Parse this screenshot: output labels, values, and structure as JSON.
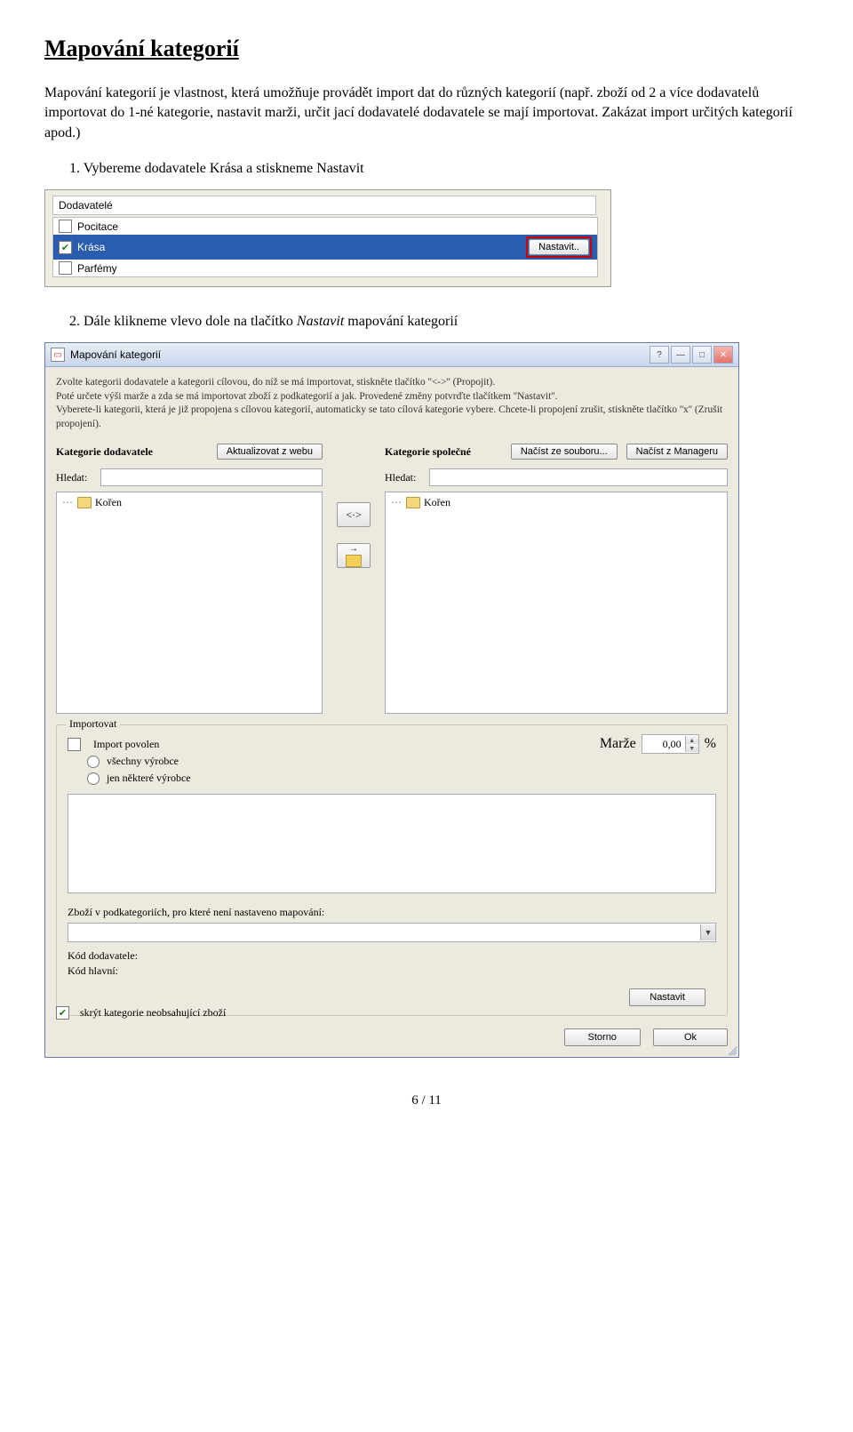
{
  "doc": {
    "title": "Mapování kategorií",
    "intro": "Mapování kategorií je vlastnost, která umožňuje provádět import dat do různých kategorií (např. zboží od 2 a více dodavatelů importovat do 1-né kategorie, nastavit marži, určit jací dodavatelé dodavatele se mají importovat. Zakázat import určitých kategorií apod.)",
    "step1": "1. Vybereme dodavatele Krása a stiskneme Nastavit",
    "step2_pre": "2. Dále klikneme vlevo dole na tlačítko ",
    "step2_btn": "Nastavit",
    "step2_post": " mapování kategorií",
    "page": "6 / 11"
  },
  "s1": {
    "header": "Dodavatelé",
    "items": [
      {
        "label": "Pocitace",
        "checked": false,
        "selected": false
      },
      {
        "label": "Krása",
        "checked": true,
        "selected": true
      },
      {
        "label": "Parfémy",
        "checked": false,
        "selected": false
      }
    ],
    "btn": "Nastavit.."
  },
  "s2": {
    "title": "Mapování kategorií",
    "info_l1": "Zvolte kategorii dodavatele a kategorii cílovou, do níž se má importovat, stiskněte tlačítko ''<->'' (Propojit).",
    "info_l2": "Poté určete výši marže a zda se má importovat zboží z podkategorií a jak. Provedené změny potvrďte tlačítkem ''Nastavit''.",
    "info_l3": "Vyberete-li kategorii, která je již propojena s cílovou kategorií, automaticky se tato cílová kategorie vybere. Chcete-li propojení zrušit, stiskněte tlačítko ''x'' (Zrušit propojení).",
    "left_header": "Kategorie dodavatele",
    "left_btn": "Aktualizovat z webu",
    "right_header": "Kategorie společné",
    "right_btn1": "Načíst ze souboru...",
    "right_btn2": "Načíst z Manageru",
    "search_label": "Hledat:",
    "root_label": "Kořen",
    "link_btn": "<·>",
    "importovat": {
      "legend": "Importovat",
      "povolen": "Import povolen",
      "all": "všechny výrobce",
      "some": "jen některé výrobce",
      "marze_label": "Marže",
      "marze_value": "0,00",
      "pct": "%",
      "subcat_label": "Zboží v podkategoriích, pro které není nastaveno mapování:",
      "code_sup": "Kód dodavatele:",
      "code_main": "Kód hlavní:",
      "nastavit": "Nastavit"
    },
    "hide_checkbox": "skrýt kategorie neobsahující zboží",
    "storno": "Storno",
    "ok": "Ok"
  }
}
